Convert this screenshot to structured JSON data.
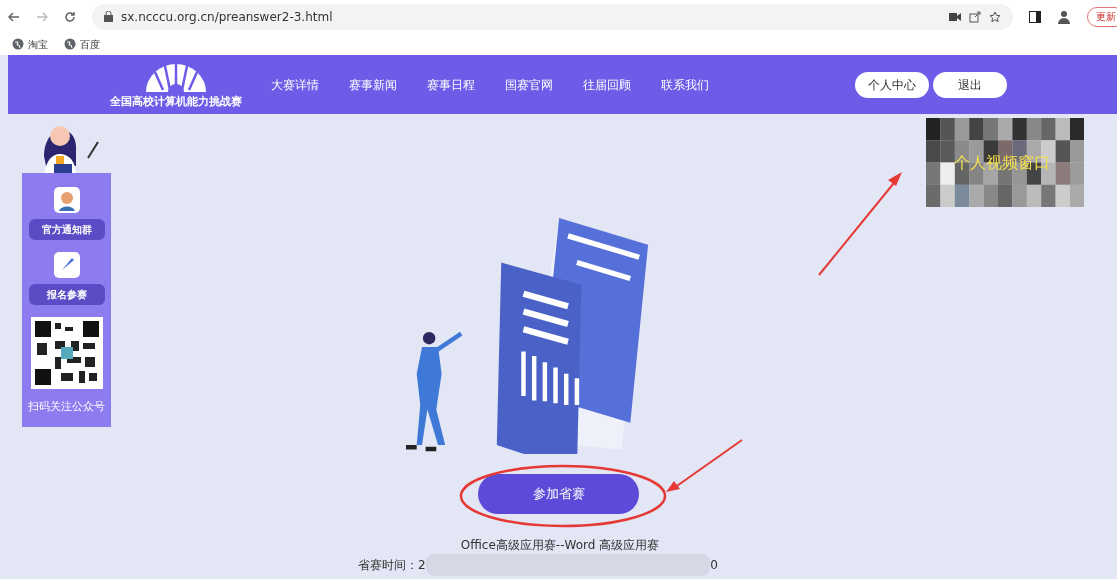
{
  "browser": {
    "url": "sx.ncccu.org.cn/preanswer2-3.html",
    "update_button": "更新",
    "bookmarks": [
      "淘宝",
      "百度"
    ]
  },
  "header": {
    "logo_caption": "全国高校计算机能力挑战赛",
    "nav": [
      "大赛详情",
      "赛事新闻",
      "赛事日程",
      "国赛官网",
      "往届回顾",
      "联系我们"
    ],
    "buttons": [
      "个人中心",
      "退出"
    ]
  },
  "sidebar": {
    "items": [
      "官方通知群",
      "报名参赛"
    ],
    "qr_caption": "扫码关注公众号"
  },
  "video_window": {
    "label": "个人视频窗口"
  },
  "main": {
    "join_button": "参加省赛",
    "contest_name": "Office高级应用赛--Word 高级应用赛",
    "time_label": "省赛时间：2",
    "time_tail": "0"
  }
}
